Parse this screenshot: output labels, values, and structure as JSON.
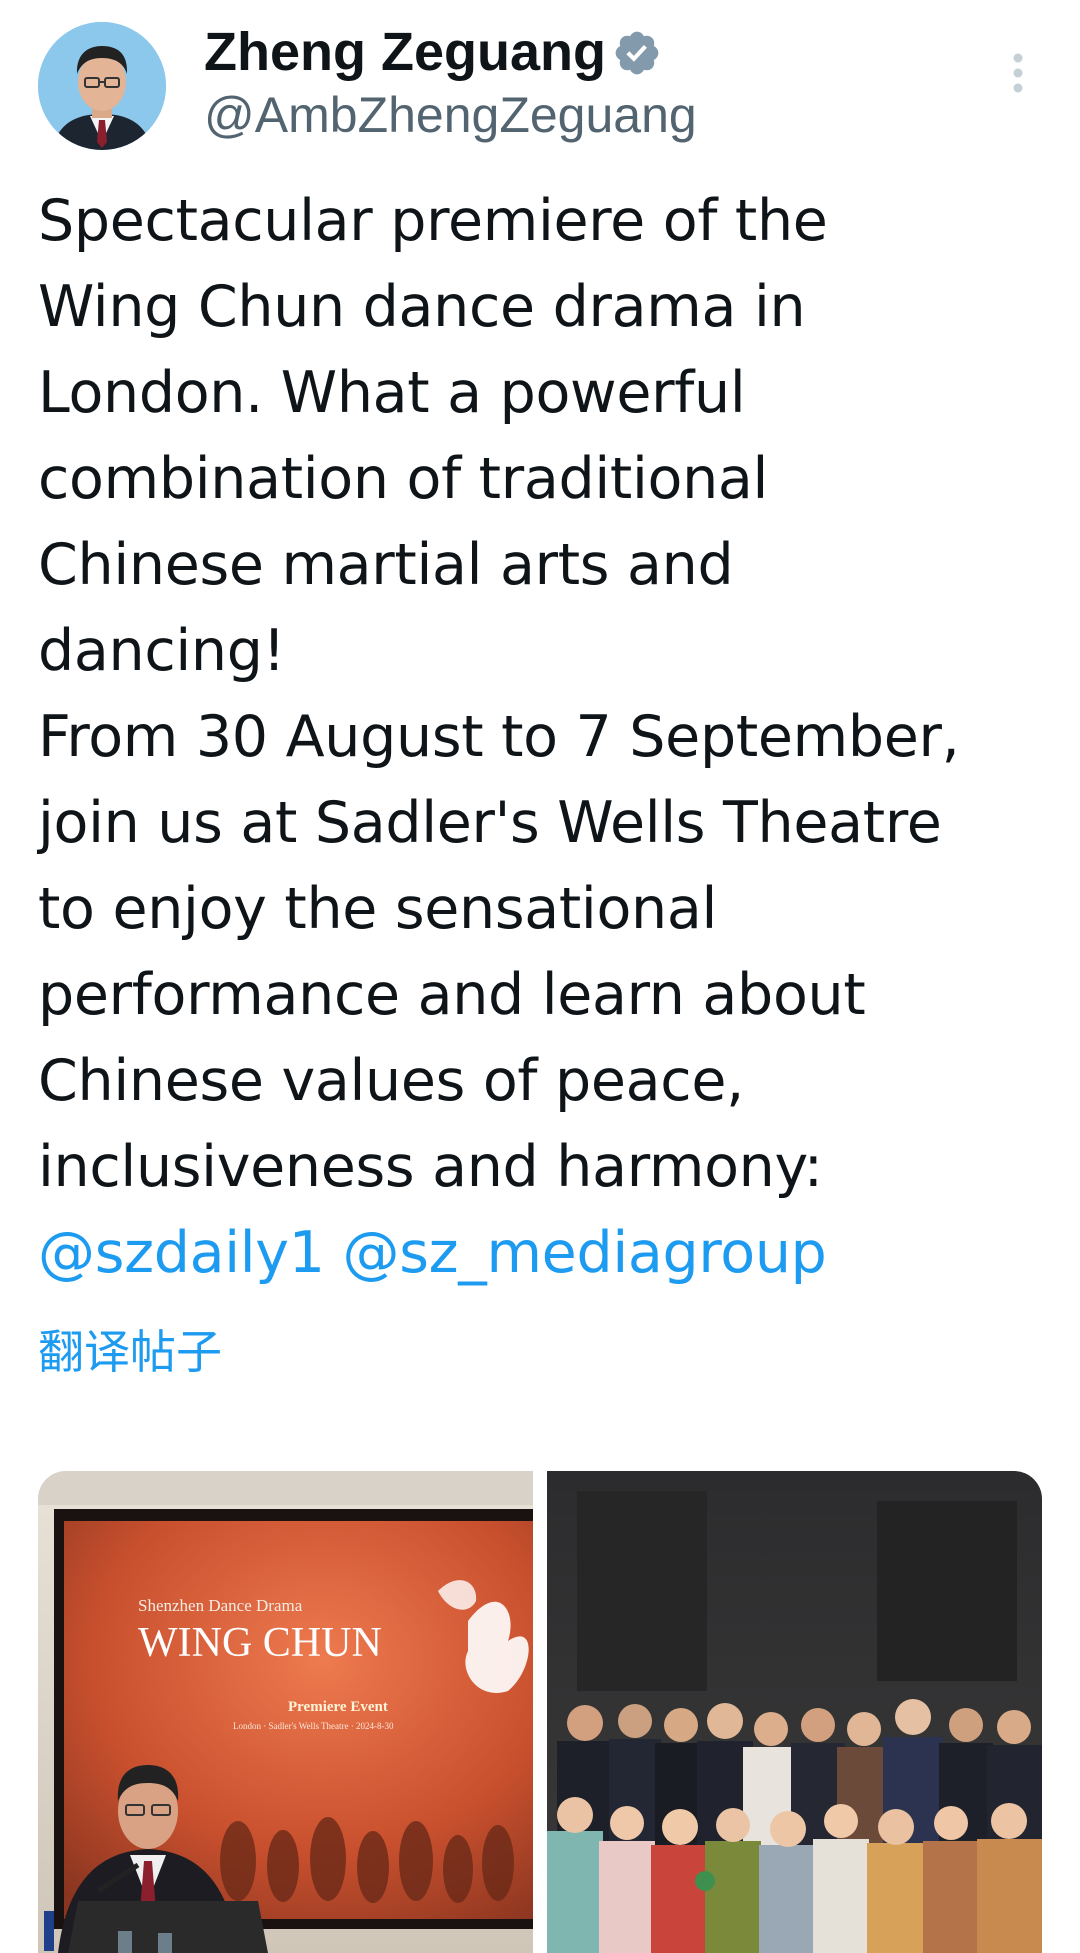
{
  "author": {
    "display_name": "Zheng Zeguang",
    "handle": "@AmbZhengZeguang",
    "verified": true
  },
  "tweet": {
    "lines": [
      "Spectacular premiere of the",
      "Wing Chun dance drama in",
      "London. What a powerful",
      "combination of traditional",
      "Chinese martial arts and",
      "dancing!",
      "From 30 August to 7 September,",
      "join us at Sadler's Wells Theatre",
      "to enjoy the sensational",
      "performance and learn about",
      "Chinese values of peace,",
      "inclusiveness and harmony:"
    ],
    "mentions": [
      "@szdaily1",
      "@sz_mediagroup"
    ],
    "translate_label": "翻译帖子"
  },
  "media": {
    "poster": {
      "line1": "Shenzhen Dance Drama",
      "title": "WING CHUN",
      "event": "Premiere Event",
      "venue": "London · Sadler's Wells Theatre · 2024-8-30"
    }
  },
  "colors": {
    "link": "#1d9bf0",
    "handle": "#536471",
    "verified": "#829aab"
  },
  "icons": {
    "verified": "verified-badge-icon",
    "more": "more-vertical-icon"
  }
}
